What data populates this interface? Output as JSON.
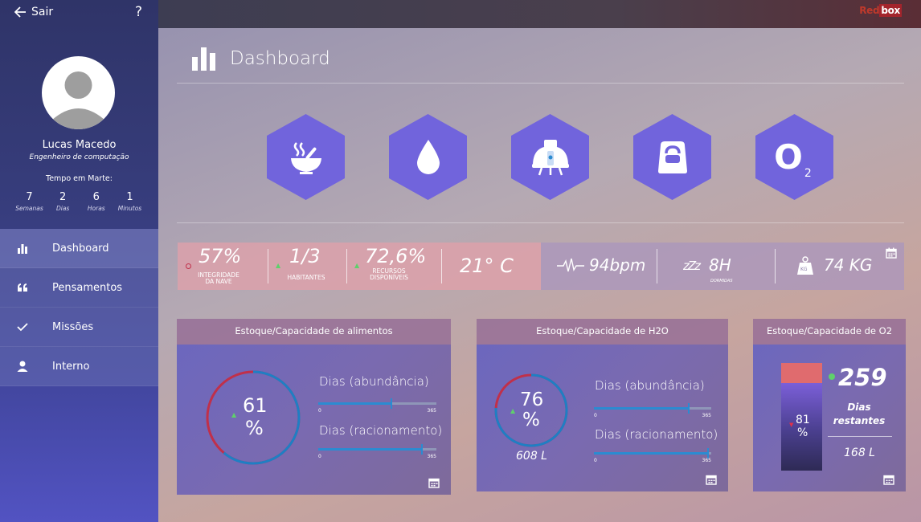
{
  "sidebar": {
    "back_label": "Sair",
    "help_label": "?",
    "user_name": "Lucas Macedo",
    "user_role": "Engenheiro de computação",
    "mars_title": "Tempo em Marte:",
    "counters": [
      {
        "value": "7",
        "unit": "Semanas"
      },
      {
        "value": "2",
        "unit": "Dias"
      },
      {
        "value": "6",
        "unit": "Horas"
      },
      {
        "value": "1",
        "unit": "Minutos"
      }
    ],
    "nav": [
      {
        "label": "Dashboard",
        "icon": "bar-chart-icon"
      },
      {
        "label": "Pensamentos",
        "icon": "quote-icon"
      },
      {
        "label": "Missões",
        "icon": "check-icon"
      },
      {
        "label": "Interno",
        "icon": "person-icon"
      }
    ]
  },
  "header": {
    "brand_part1": "Red",
    "brand_part2": "box"
  },
  "main": {
    "title": "Dashboard",
    "categories": [
      {
        "icon": "food-bowl-icon"
      },
      {
        "icon": "water-drop-icon"
      },
      {
        "icon": "habitat-module-icon"
      },
      {
        "icon": "weight-icon"
      },
      {
        "icon": "oxygen-icon",
        "text": "O",
        "sub": "2"
      }
    ]
  },
  "status": {
    "integrity": {
      "value": "57%",
      "label1": "INTEGRIDADE",
      "label2": "DA NAVE"
    },
    "inhabitants": {
      "value": "1/3",
      "label": "HABITANTES"
    },
    "resources": {
      "value": "72,6%",
      "label1": "RECURSOS",
      "label2": "DISPONÍVEIS"
    },
    "temperature": {
      "value": "21° C"
    },
    "heart": {
      "value": "94bpm"
    },
    "sleep": {
      "value": "8H",
      "label": "DORMIDAS",
      "zz": "zZz"
    },
    "weight": {
      "value": "74 KG",
      "icon_text": "KG"
    }
  },
  "cards": {
    "food": {
      "title": "Estoque/Capacidade de alimentos",
      "gauge_num": "61",
      "gauge_pct": "%",
      "gauge_value": 0.61,
      "slider1_label": "Dias (abundância)",
      "slider1_value": 0.62,
      "slider2_label": "Dias (racionamento)",
      "slider2_value": 0.88,
      "min": "0",
      "max": "365"
    },
    "water": {
      "title": "Estoque/Capacidade de H2O",
      "gauge_num": "76",
      "gauge_pct": "%",
      "gauge_value": 0.76,
      "gauge_sub": "608 L",
      "slider1_label": "Dias (abundância)",
      "slider1_value": 0.81,
      "slider2_label": "Dias (racionamento)",
      "slider2_value": 0.97,
      "min": "0",
      "max": "365"
    },
    "oxygen": {
      "title": "Estoque/Capacidade de O2",
      "bar_num": "81",
      "bar_pct": "%",
      "bar_value": 0.81,
      "days": "259",
      "days_label1": "Dias",
      "days_label2": "restantes",
      "liters": "168 L"
    }
  },
  "colors": {
    "accent_blue": "#2b8bd1",
    "gauge_red": "#c0304a",
    "hex_purple": "#7164dc",
    "brand_red": "#a3242c"
  }
}
